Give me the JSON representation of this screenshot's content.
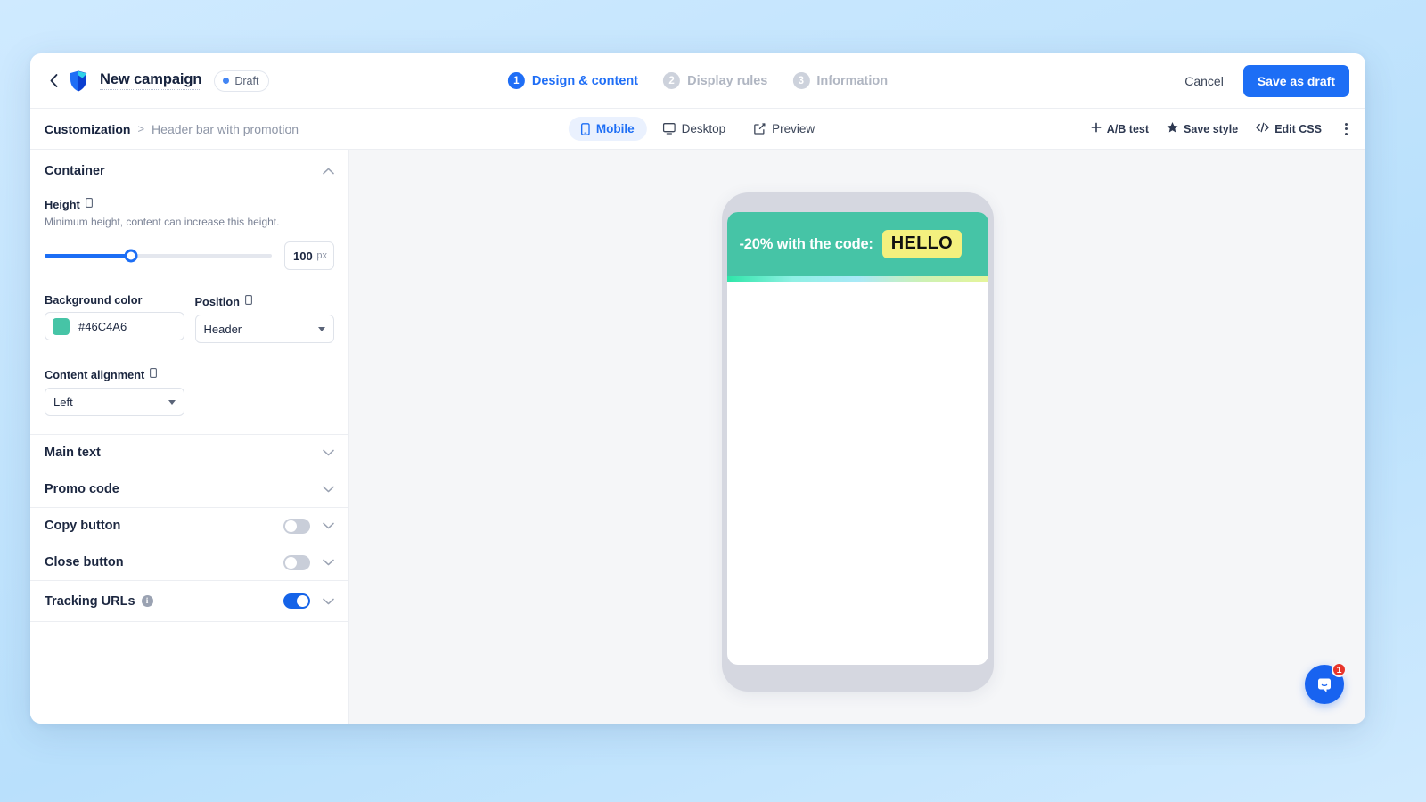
{
  "topbar": {
    "back_icon": "chevron-left-icon",
    "logo_icon": "brand-logo-icon",
    "campaign_title": "New campaign",
    "status_badge": "Draft",
    "cancel_label": "Cancel",
    "save_draft_label": "Save as draft",
    "steps": [
      {
        "num": "1",
        "label": "Design & content",
        "active": true
      },
      {
        "num": "2",
        "label": "Display rules",
        "active": false
      },
      {
        "num": "3",
        "label": "Information",
        "active": false
      }
    ]
  },
  "subbar": {
    "breadcrumb_root": "Customization",
    "breadcrumb_sep": ">",
    "breadcrumb_leaf": "Header bar with promotion",
    "views": [
      {
        "label": "Mobile",
        "icon": "mobile-icon",
        "active": true
      },
      {
        "label": "Desktop",
        "icon": "desktop-icon",
        "active": false
      },
      {
        "label": "Preview",
        "icon": "external-link-icon",
        "active": false
      }
    ],
    "tools": [
      {
        "label": "A/B test",
        "icon": "plus-icon"
      },
      {
        "label": "Save style",
        "icon": "star-icon"
      },
      {
        "label": "Edit CSS",
        "icon": "code-icon"
      }
    ],
    "more_icon": "kebab-menu-icon"
  },
  "panel": {
    "container": {
      "title": "Container",
      "collapse_icon": "chevron-up-icon",
      "height": {
        "label": "Height",
        "device_icon": "mobile-icon",
        "hint": "Minimum height, content can increase this height.",
        "value": "100",
        "unit": "px",
        "slider_percent": 38
      },
      "background_color": {
        "label": "Background color",
        "value": "#46C4A6",
        "swatch_hex": "#46C4A6"
      },
      "position": {
        "label": "Position",
        "device_icon": "mobile-icon",
        "value": "Header"
      },
      "content_alignment": {
        "label": "Content alignment",
        "device_icon": "mobile-icon",
        "value": "Left"
      }
    },
    "sections": [
      {
        "title": "Main text",
        "has_toggle": false,
        "toggle_on": false,
        "has_info": false
      },
      {
        "title": "Promo code",
        "has_toggle": false,
        "toggle_on": false,
        "has_info": false
      },
      {
        "title": "Copy button",
        "has_toggle": true,
        "toggle_on": false,
        "has_info": false
      },
      {
        "title": "Close button",
        "has_toggle": true,
        "toggle_on": false,
        "has_info": false
      },
      {
        "title": "Tracking URLs",
        "has_toggle": true,
        "toggle_on": true,
        "has_info": true
      }
    ]
  },
  "preview": {
    "device": "mobile-phone-frame",
    "banner": {
      "text": "-20% with the code:",
      "code": "HELLO",
      "background_color": "#46C4A6",
      "code_background": "#F4F07E",
      "text_color": "#FFFFFF",
      "strip_colors": [
        "#2ee6a8",
        "#8ff0e4",
        "#a9e9f7",
        "#cdf1b4",
        "#e6f59a"
      ]
    }
  },
  "chat": {
    "icon": "chat-bubble-icon",
    "badge_count": "1",
    "color": "#1863F0"
  }
}
